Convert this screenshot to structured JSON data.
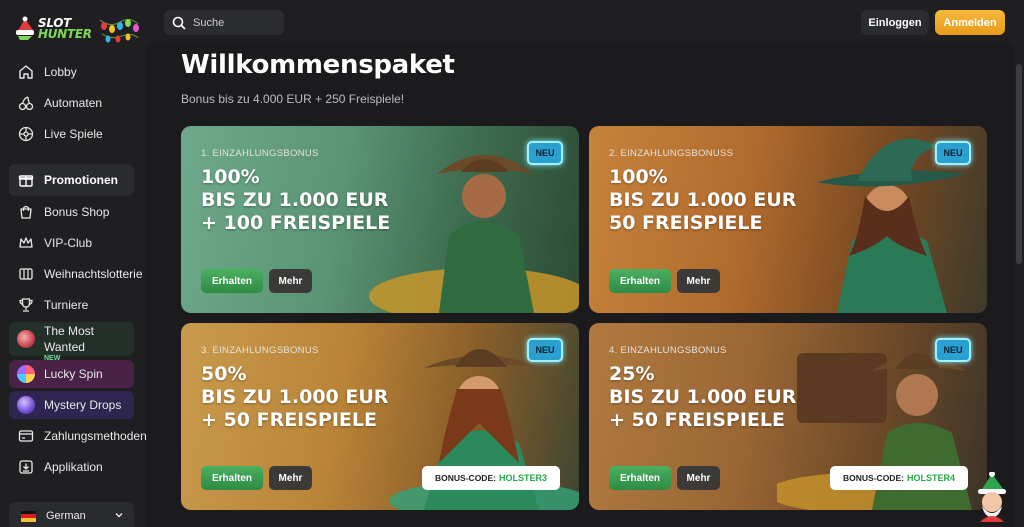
{
  "brand": {
    "line1": "SLOT",
    "line2": "HUNTER"
  },
  "header": {
    "search_placeholder": "Suche",
    "login_label": "Einloggen",
    "register_label": "Anmelden"
  },
  "sidebar": {
    "items": [
      {
        "label": "Lobby",
        "icon": "home-icon"
      },
      {
        "label": "Automaten",
        "icon": "cherries-icon"
      },
      {
        "label": "Live Spiele",
        "icon": "roulette-icon"
      },
      {
        "label": "Promotionen",
        "icon": "gift-icon",
        "active": true
      },
      {
        "label": "Bonus Shop",
        "icon": "shopping-bag-icon"
      },
      {
        "label": "VIP-Club",
        "icon": "crown-icon"
      },
      {
        "label": "Weihnachtslotterie",
        "icon": "lottery-icon"
      },
      {
        "label": "Turniere",
        "icon": "trophy-icon"
      },
      {
        "label": "The Most Wanted",
        "icon": "wanted-badge-icon"
      },
      {
        "label": "Lucky Spin",
        "icon": "lucky-wheel-icon",
        "badge": "NEW"
      },
      {
        "label": "Mystery Drops",
        "icon": "mystery-drop-icon"
      },
      {
        "label": "Zahlungsmethoden",
        "icon": "wallet-icon"
      },
      {
        "label": "Applikation",
        "icon": "download-icon"
      }
    ],
    "language": "German"
  },
  "main": {
    "title": "Willkommenspaket",
    "subtitle": "Bonus bis zu 4.000 EUR + 250 Freispiele!",
    "cards": [
      {
        "label": "1. EINZAHLUNGSBONUS",
        "line1": "100%",
        "line2": "BIS ZU 1.000 EUR",
        "line3": "+ 100 FREISPIELE",
        "badge": "NEU",
        "get_label": "Erhalten",
        "more_label": "Mehr",
        "code_label": "",
        "code_value": ""
      },
      {
        "label": "2. EINZAHLUNGSBONUSS",
        "line1": "100%",
        "line2": "BIS ZU 1.000 EUR",
        "line3": "50 FREISPIELE",
        "badge": "NEU",
        "get_label": "Erhalten",
        "more_label": "Mehr",
        "code_label": "",
        "code_value": ""
      },
      {
        "label": "3. EINZAHLUNGSBONUS",
        "line1": "50%",
        "line2": "BIS ZU 1.000 EUR",
        "line3": "+ 50 FREISPIELE",
        "badge": "NEU",
        "get_label": "Erhalten",
        "more_label": "Mehr",
        "code_label": "BONUS-CODE:",
        "code_value": "HOLSTER3"
      },
      {
        "label": "4. EINZAHLUNGSBONUS",
        "line1": "25%",
        "line2": "BIS ZU 1.000 EUR",
        "line3": "+ 50 FREISPIELE",
        "badge": "NEU",
        "get_label": "Erhalten",
        "more_label": "Mehr",
        "code_label": "BONUS-CODE:",
        "code_value": "HOLSTER4"
      }
    ]
  },
  "colors": {
    "background": "#1b1b1d",
    "accent_orange": "#f0a52a",
    "button_green": "#3a9d52",
    "code_green": "#27a84a"
  }
}
